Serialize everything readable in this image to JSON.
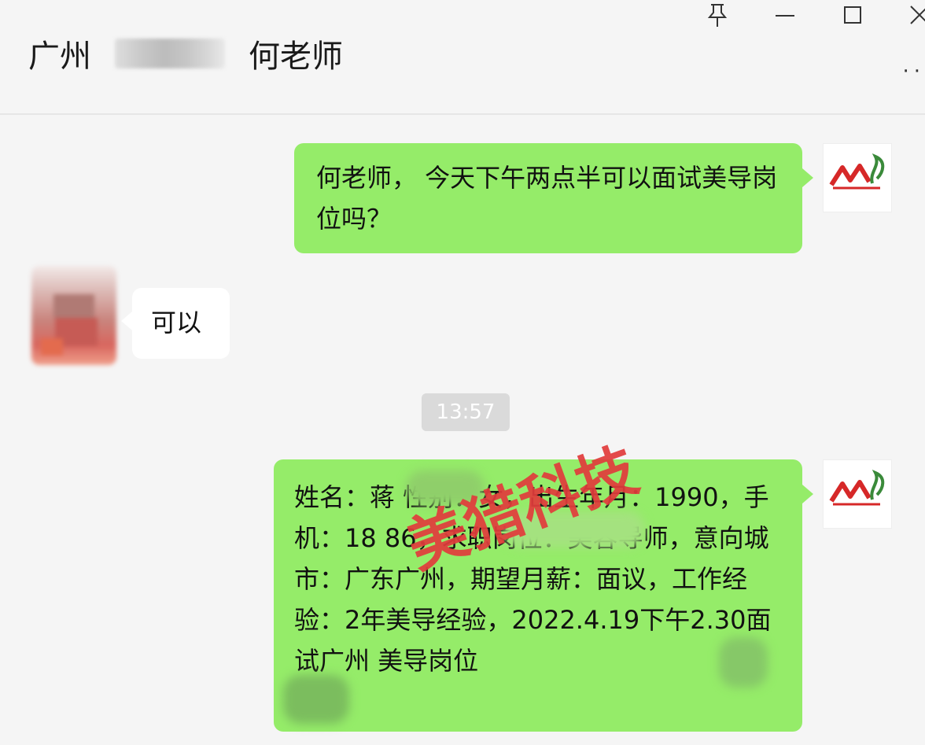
{
  "window": {
    "title_prefix": "广州",
    "title_suffix": "何老师",
    "controls": [
      "pin-icon",
      "minimize-icon",
      "maximize-icon",
      "close-icon"
    ],
    "more_label": "··"
  },
  "colors": {
    "my_bubble": "#95ec69",
    "their_bubble": "#ffffff",
    "watermark": "#e23c3c",
    "background": "#f5f5f5"
  },
  "messages": [
    {
      "from": "me",
      "text": "何老师， 今天下午两点半可以面试美导岗位吗？"
    },
    {
      "from": "other",
      "text": "可以"
    },
    {
      "type": "timestamp",
      "text": "13:57"
    },
    {
      "from": "me",
      "text": "姓名：蒋 性别：女，出生年月：1990，手机：18 86，求职岗位：美容导师，意向城市：广东广州，期望月薪：面议，工作经验：2年美导经验，2022.4.19下午2.30面试广州 美导岗位"
    }
  ],
  "watermark": "美猎科技"
}
